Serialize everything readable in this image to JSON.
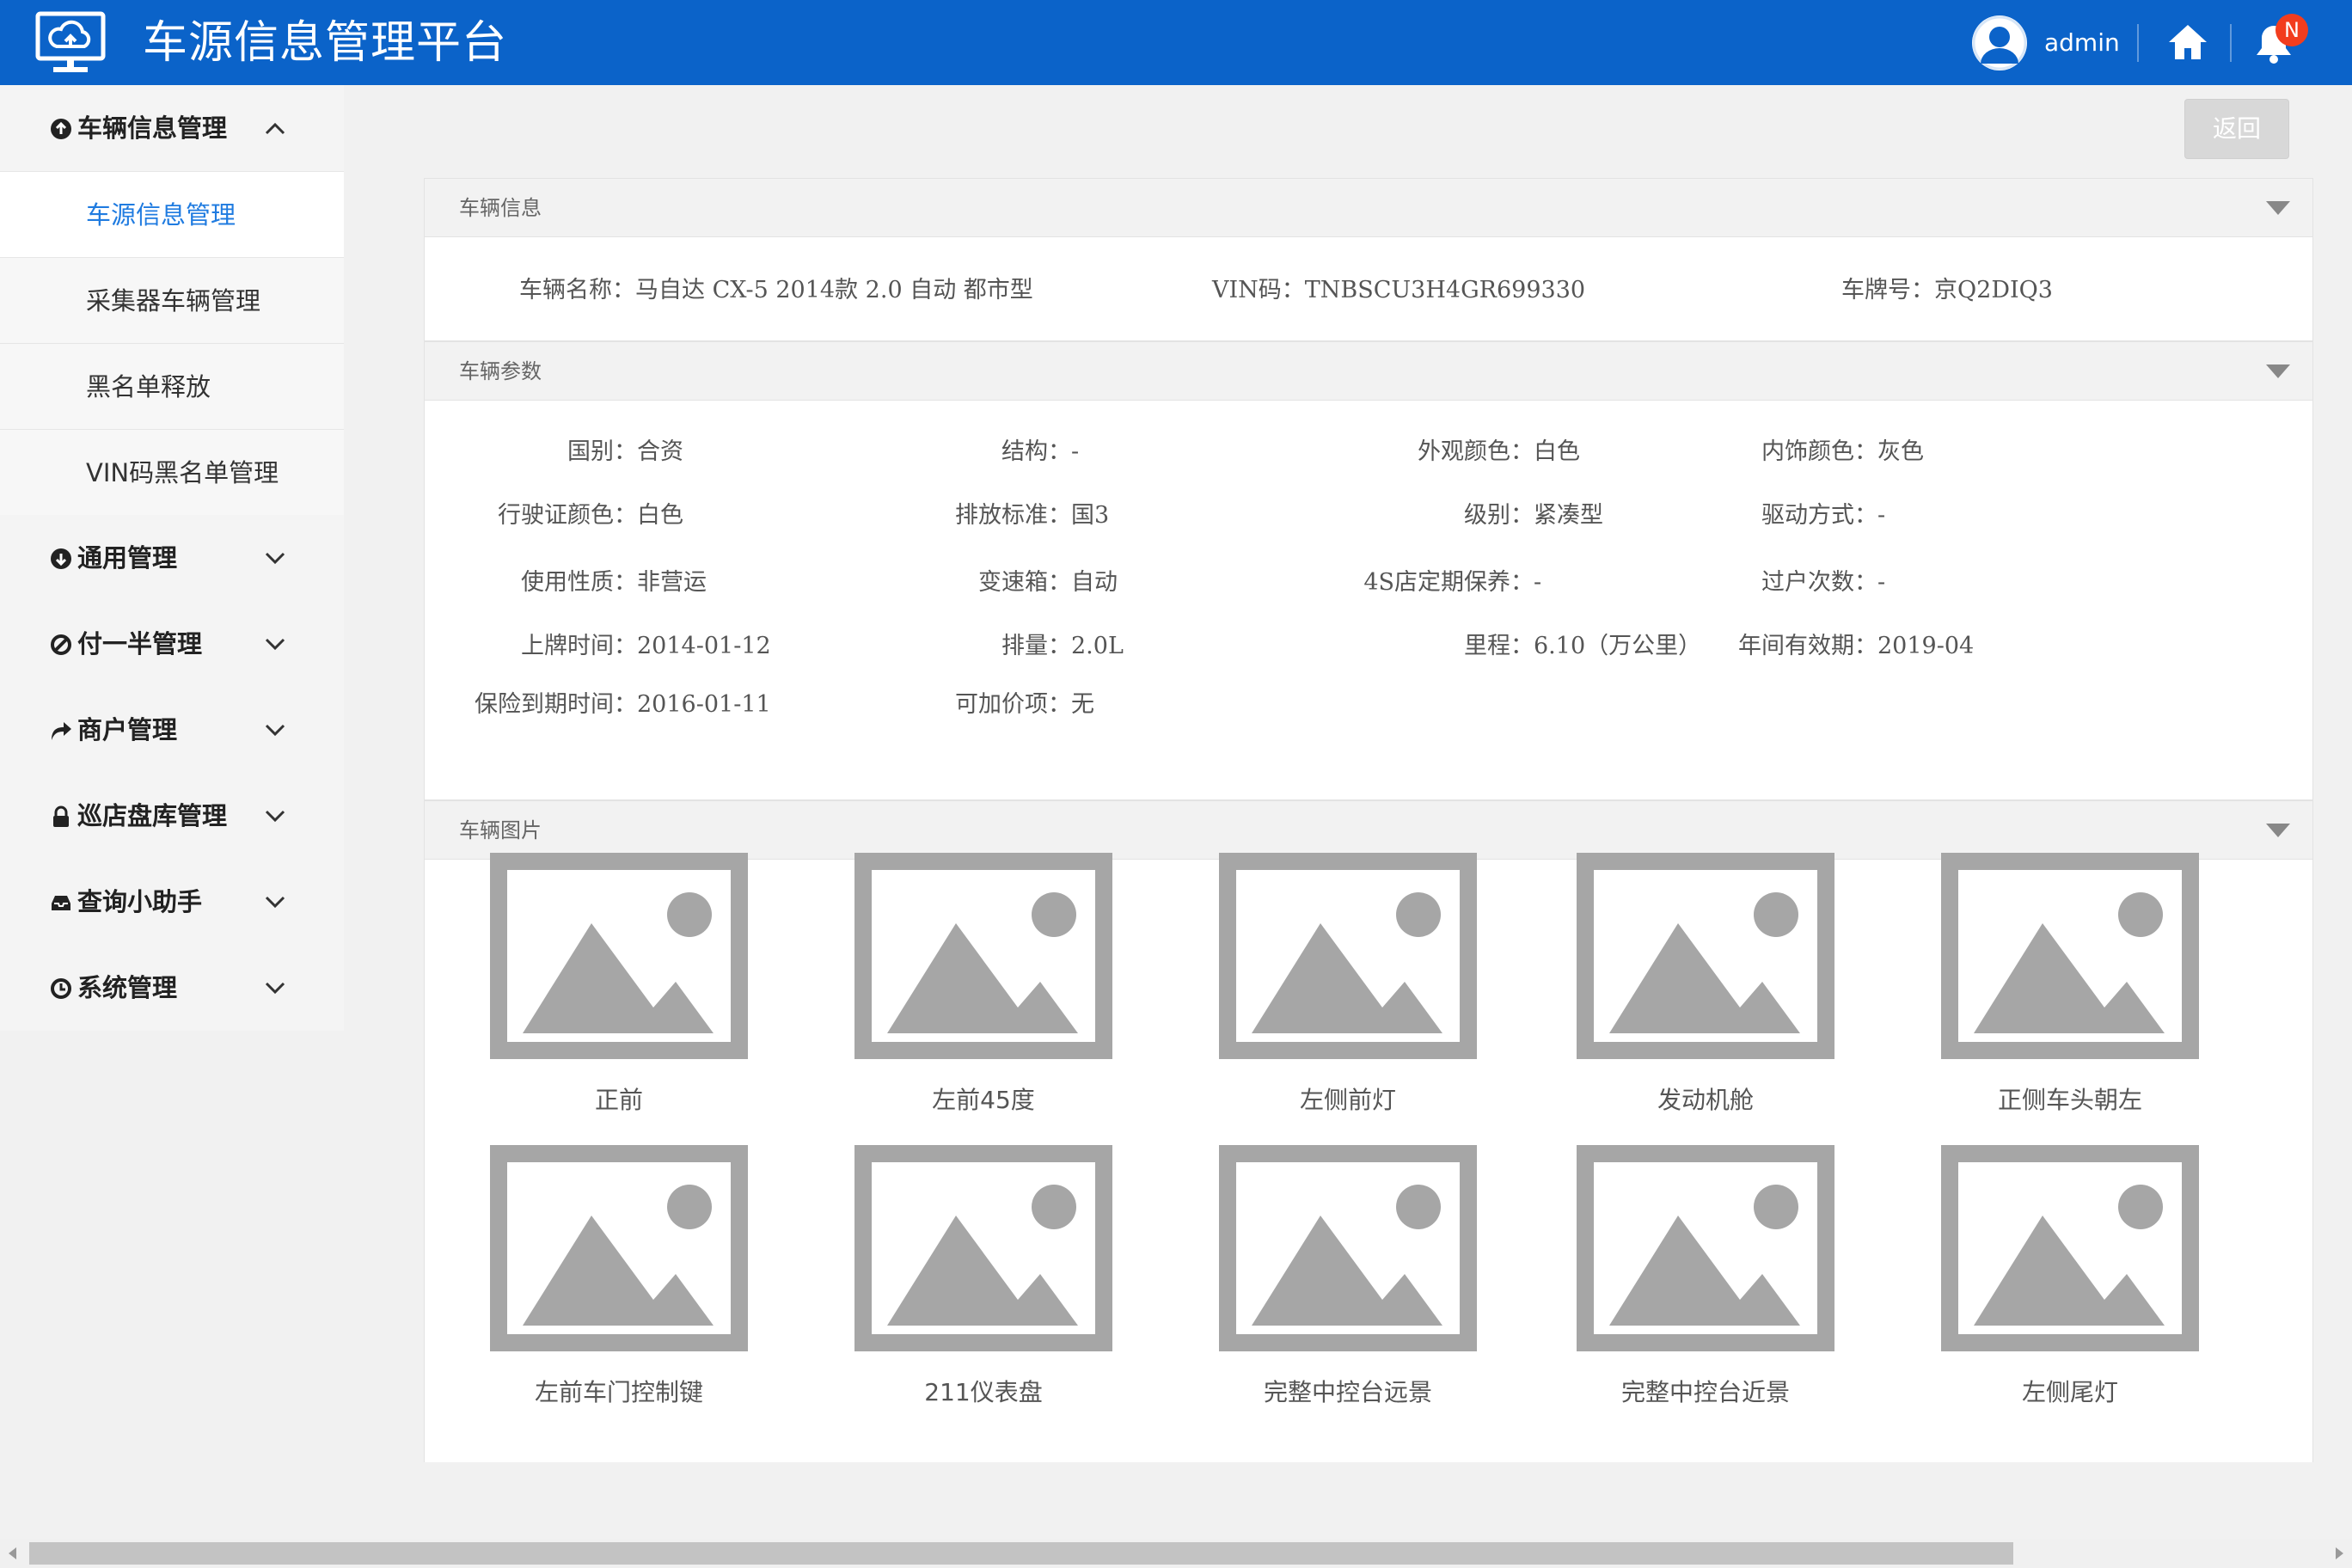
{
  "header": {
    "title": "车源信息管理平台",
    "user": "admin",
    "badge": "N",
    "bg_color": "#0b63c9"
  },
  "sidebar": {
    "groups": [
      {
        "label": "车辆信息管理",
        "icon": "arrow-up-circle-icon",
        "expanded": true,
        "items": [
          {
            "label": "车源信息管理",
            "active": true
          },
          {
            "label": "采集器车辆管理"
          },
          {
            "label": "黑名单释放"
          },
          {
            "label": "VIN码黑名单管理"
          }
        ]
      },
      {
        "label": "通用管理",
        "icon": "arrow-down-circle-icon"
      },
      {
        "label": "付一半管理",
        "icon": "ban-circle-icon"
      },
      {
        "label": "商户管理",
        "icon": "share-arrow-icon"
      },
      {
        "label": "巡店盘库管理",
        "icon": "lock-icon"
      },
      {
        "label": "查询小助手",
        "icon": "inbox-icon"
      },
      {
        "label": "系统管理",
        "icon": "clock-icon"
      }
    ]
  },
  "main": {
    "back_label": "返回",
    "vehicle_info": {
      "title": "车辆信息",
      "fields": [
        {
          "label": "车辆名称：",
          "value": "马自达 CX-5 2014款 2.0 自动 都市型"
        },
        {
          "label": "VIN码：",
          "value": "TNBSCU3H4GR699330"
        },
        {
          "label": "车牌号：",
          "value": "京Q2DIQ3"
        }
      ]
    },
    "vehicle_params": {
      "title": "车辆参数",
      "fields": [
        {
          "label": "国别：",
          "value": "合资"
        },
        {
          "label": "结构：",
          "value": "-"
        },
        {
          "label": "外观颜色：",
          "value": "白色"
        },
        {
          "label": "内饰颜色：",
          "value": "灰色"
        },
        {
          "label": "行驶证颜色：",
          "value": "白色"
        },
        {
          "label": "排放标准：",
          "value": "国3"
        },
        {
          "label": "级别：",
          "value": "紧凑型"
        },
        {
          "label": "驱动方式：",
          "value": "-"
        },
        {
          "label": "使用性质：",
          "value": "非营运"
        },
        {
          "label": "变速箱：",
          "value": "自动"
        },
        {
          "label": "4S店定期保养：",
          "value": "-"
        },
        {
          "label": "过户次数：",
          "value": "-"
        },
        {
          "label": "上牌时间：",
          "value": "2014-01-12"
        },
        {
          "label": "排量：",
          "value": "2.0L"
        },
        {
          "label": "里程：",
          "value": "6.10（万公里）"
        },
        {
          "label": "年间有效期：",
          "value": "2019-04"
        },
        {
          "label": "保险到期时间：",
          "value": "2016-01-11"
        },
        {
          "label": "可加价项：",
          "value": "无"
        }
      ]
    },
    "vehicle_photos": {
      "title": "车辆图片",
      "photos": [
        "正前",
        "左前45度",
        "左侧前灯",
        "发动机舱",
        "正侧车头朝左",
        "左前车门控制键",
        "211仪表盘",
        "完整中控台远景",
        "完整中控台近景",
        "左侧尾灯"
      ]
    }
  }
}
